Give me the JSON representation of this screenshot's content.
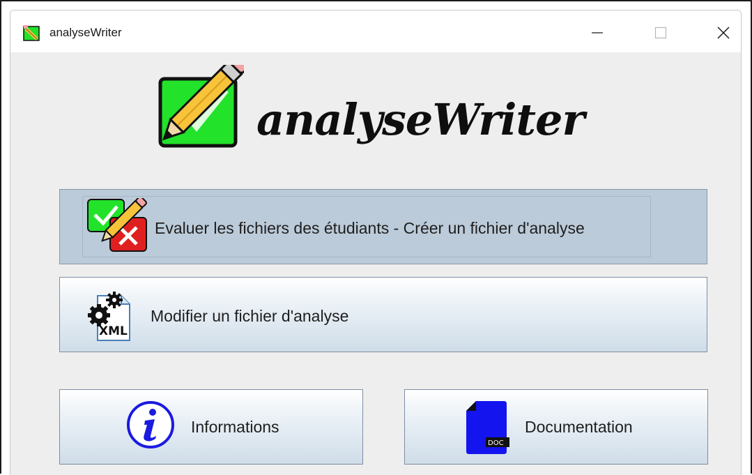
{
  "window": {
    "title": "analyseWriter",
    "controls": {
      "minimize": "minimize-icon",
      "maximize": "maximize-icon",
      "close": "close-icon"
    }
  },
  "logo": {
    "text": "analyseWriter"
  },
  "buttons": {
    "evaluer": {
      "label": "Evaluer les fichiers des étudiants - Créer un fichier d'analyse",
      "icon": "pencil-check-cross-icon"
    },
    "modifier": {
      "label": "Modifier un fichier d'analyse",
      "icon": "xml-gears-icon"
    },
    "informations": {
      "label": "Informations",
      "icon": "info-icon"
    },
    "documentation": {
      "label": "Documentation",
      "icon": "doc-file-icon",
      "icon_text": "DOC"
    }
  },
  "colors": {
    "window_bg": "#eeeeee",
    "button_active_bg": "#bccbd9",
    "logo_green": "#22e22a",
    "pencil_yellow": "#f7c33a",
    "cross_red": "#e02020",
    "info_blue": "#1a1ae0",
    "doc_blue": "#1414ee"
  }
}
